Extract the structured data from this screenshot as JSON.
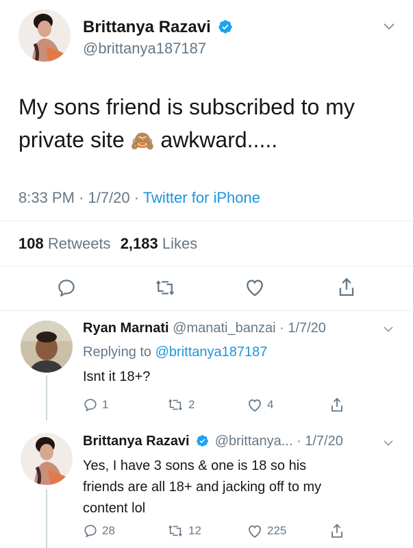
{
  "colors": {
    "accent": "#1b95e0",
    "muted": "#657786",
    "divider": "#e6ecf0",
    "verified": "#1da1f2"
  },
  "main_tweet": {
    "name": "Brittanya Razavi",
    "handle": "@brittanya187187",
    "text_line1": "My sons friend is subscribed to my",
    "text_pre_emoji": "private site",
    "emoji": "🙈",
    "text_post_emoji": "awkward.....",
    "time": "8:33 PM · 1/7/20 ·",
    "source": "Twitter for iPhone",
    "retweets_count": "108",
    "retweets_label": "Retweets",
    "likes_count": "2,183",
    "likes_label": "Likes"
  },
  "reply1": {
    "name": "Ryan Marnati",
    "handle": "@manati_banzai",
    "date": "· 1/7/20",
    "replying_prefix": "Replying to",
    "replying_handle": "@brittanya187187",
    "text": "Isnt it 18+?",
    "reply_count": "1",
    "retweet_count": "2",
    "like_count": "4"
  },
  "reply2": {
    "name": "Brittanya Razavi",
    "handle": "@brittanya...",
    "date": "· 1/7/20",
    "text_line1": "Yes, I have 3 sons & one is 18 so his",
    "text_line2": "friends are all 18+ and jacking off to my",
    "text_line3": "content lol",
    "reply_count": "28",
    "retweet_count": "12",
    "like_count": "225"
  }
}
